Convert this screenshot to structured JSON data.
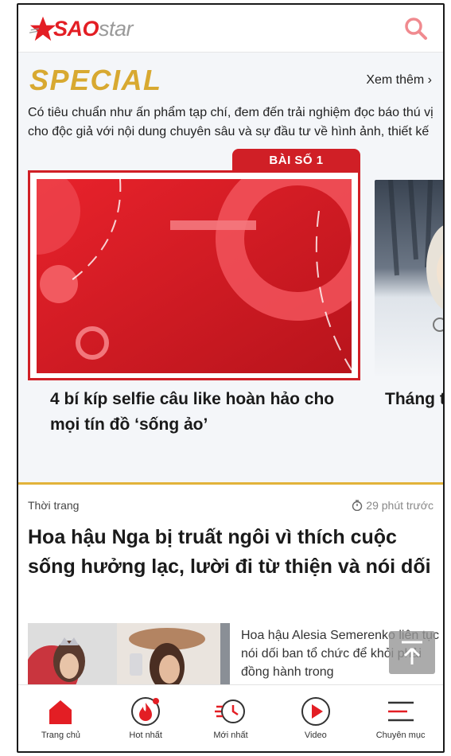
{
  "header": {
    "logo_prefix": "SAO",
    "logo_suffix": "star",
    "brand_color": "#e31e24",
    "icons": {
      "search": "search-icon"
    }
  },
  "special": {
    "title": "SPECIAL",
    "see_more": "Xem thêm ›",
    "description": "Có tiêu chuẩn như ấn phẩm tạp chí, đem đến trải nghiệm đọc báo thú vị cho độc giả với nội dung chuyên sâu và sự đầu tư về hình ảnh, thiết kế",
    "accent_color": "#d8a931",
    "cards": [
      {
        "tab": "BÀI SỐ 1",
        "title": "4 bí kíp selfie câu like hoàn hảo cho mọi tín đồ ‘sống ảo’"
      },
      {
        "title": "Tháng trong ‘ nên lịc"
      }
    ]
  },
  "article": {
    "category": "Thời trang",
    "time_ago": "29 phút trước",
    "headline": "Hoa hậu Nga bị truất ngôi vì thích cuộc sống hưởng lạc, lười đi từ thiện và nói dối",
    "excerpt": "Hoa hậu Alesia Semerenko liên tục nói dối ban tổ chức để khỏi phải đồng hành trong"
  },
  "bottom_nav": [
    {
      "label": "Trang chủ",
      "icon": "home-icon",
      "active": true
    },
    {
      "label": "Hot nhất",
      "icon": "fire-icon"
    },
    {
      "label": "Mới nhất",
      "icon": "clock-icon"
    },
    {
      "label": "Video",
      "icon": "play-icon"
    },
    {
      "label": "Chuyên mục",
      "icon": "menu-icon"
    }
  ]
}
